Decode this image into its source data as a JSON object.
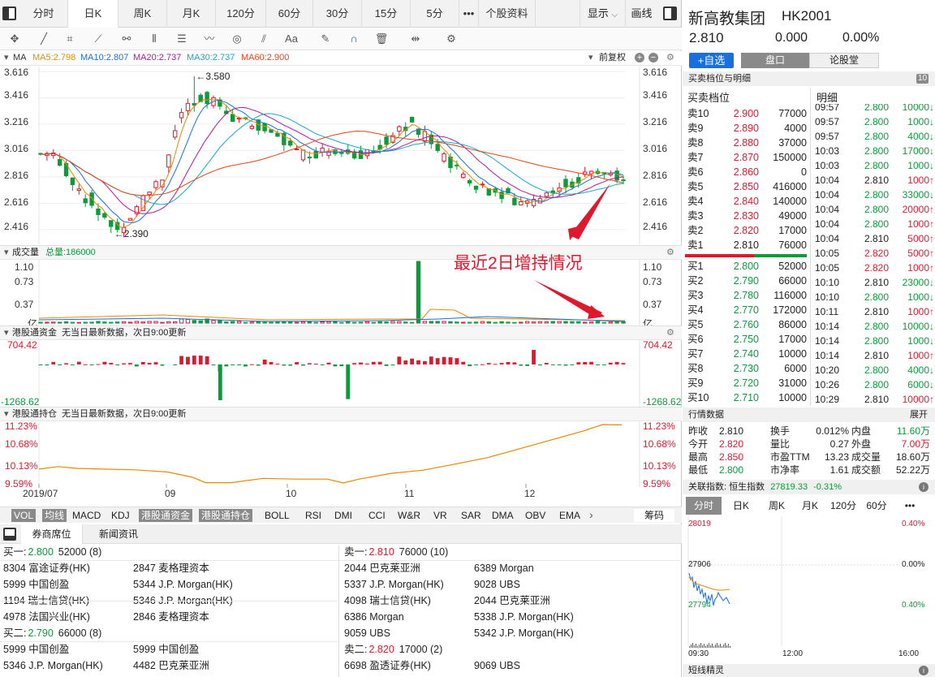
{
  "period_tabs": [
    "分时",
    "日K",
    "周K",
    "月K",
    "120分",
    "60分",
    "30分",
    "15分",
    "5分",
    "•••",
    "个股资料"
  ],
  "active_tab": 1,
  "display_label": "显示",
  "draw_label": "画线",
  "ma_panel": {
    "label": "MA",
    "ma5": "MA5:2.798",
    "ma10": "MA10:2.807",
    "ma20": "MA20:2.737",
    "ma30": "MA30:2.737",
    "ma60": "MA60:2.900",
    "adjust": "前复权"
  },
  "price_axis": [
    "3.616",
    "3.416",
    "3.216",
    "3.016",
    "2.816",
    "2.616",
    "2.416"
  ],
  "price_max_mark": "←3.580",
  "price_min_mark": "←2.390",
  "volume_panel": {
    "label": "成交量",
    "total": "总量:186000",
    "axis": [
      "1.10",
      "0.73",
      "0.37",
      "亿"
    ]
  },
  "annotation": "最近2日增持情况",
  "flow_panel": {
    "label": "港股通资金",
    "note": "无当日最新数据，次日9:00更新",
    "top": "704.42",
    "bottom": "-1268.62"
  },
  "hold_panel": {
    "label": "港股通持仓",
    "note": "无当日最新数据，次日9:00更新",
    "axis": [
      "11.23%",
      "10.68%",
      "10.13%",
      "9.59%"
    ]
  },
  "x_axis": [
    "2019/07",
    "09",
    "10",
    "11",
    "12"
  ],
  "indicators": [
    "VOL",
    "均线",
    "MACD",
    "KDJ",
    "港股通资金",
    "港股通持仓",
    "BOLL",
    "RSI",
    "DMI",
    "CCI",
    "W&R",
    "VR",
    "SAR",
    "DMA",
    "OBV",
    "EMA"
  ],
  "indicator_more": "›",
  "chip_label": "筹码",
  "bottom_tabs": [
    "券商席位",
    "新闻资讯"
  ],
  "brokers_buy": {
    "buy1_label": "买一:",
    "buy1_price": "2.800",
    "buy1_rest": "52000 (8)",
    "rows1": [
      [
        "8304 富途证券(HK)",
        "2847 麦格理资本"
      ],
      [
        "5999 中国创盈",
        "5344 J.P. Morgan(HK)"
      ],
      [
        "1194 瑞士信贷(HK)",
        "5346 J.P. Morgan(HK)"
      ],
      [
        "4978 法国兴业(HK)",
        "2846 麦格理资本"
      ]
    ],
    "buy2_label": "买二:",
    "buy2_price": "2.790",
    "buy2_rest": "66000 (8)",
    "rows2": [
      [
        "5999 中国创盈",
        "5999 中国创盈"
      ],
      [
        "5346 J.P. Morgan(HK)",
        "4482 巴克莱亚洲"
      ]
    ]
  },
  "brokers_sell": {
    "sell1_label": "卖一:",
    "sell1_price": "2.810",
    "sell1_rest": "76000 (10)",
    "rows1": [
      [
        "2044 巴克莱亚洲",
        "6389 Morgan"
      ],
      [
        "5337 J.P. Morgan(HK)",
        "9028 UBS"
      ],
      [
        "4098 瑞士信贷(HK)",
        "2044 巴克莱亚洲"
      ],
      [
        "6386 Morgan",
        "5338 J.P. Morgan(HK)"
      ],
      [
        "9059 UBS",
        "5342 J.P. Morgan(HK)"
      ]
    ],
    "sell2_label": "卖二:",
    "sell2_price": "2.820",
    "sell2_rest": "17000 (2)",
    "rows2": [
      [
        "6698 盈透证券(HK)",
        "9069 UBS"
      ]
    ]
  },
  "stock": {
    "name": "新高教集团",
    "code": "HK2001",
    "price": "2.810",
    "change": "0.000",
    "pct": "0.00%"
  },
  "right_tabs": {
    "add": "+自选",
    "book": "盘口",
    "forum": "论股堂"
  },
  "order_section": {
    "title": "买卖档位与明细",
    "badge": "10",
    "book_title": "买卖档位",
    "tick_title": "明细"
  },
  "asks": [
    [
      "卖10",
      "2.900",
      "77000"
    ],
    [
      "卖9",
      "2.890",
      "4000"
    ],
    [
      "卖8",
      "2.880",
      "37000"
    ],
    [
      "卖7",
      "2.870",
      "150000"
    ],
    [
      "卖6",
      "2.860",
      "0"
    ],
    [
      "卖5",
      "2.850",
      "416000"
    ],
    [
      "卖4",
      "2.840",
      "140000"
    ],
    [
      "卖3",
      "2.830",
      "49000"
    ],
    [
      "卖2",
      "2.820",
      "17000"
    ],
    [
      "卖1",
      "2.810",
      "76000"
    ]
  ],
  "bids": [
    [
      "买1",
      "2.800",
      "52000"
    ],
    [
      "买2",
      "2.790",
      "66000"
    ],
    [
      "买3",
      "2.780",
      "116000"
    ],
    [
      "买4",
      "2.770",
      "172000"
    ],
    [
      "买5",
      "2.760",
      "86000"
    ],
    [
      "买6",
      "2.750",
      "17000"
    ],
    [
      "买7",
      "2.740",
      "10000"
    ],
    [
      "买8",
      "2.730",
      "6000"
    ],
    [
      "买9",
      "2.720",
      "31000"
    ],
    [
      "买10",
      "2.710",
      "10000"
    ]
  ],
  "ticks": [
    [
      "09:57",
      "2.800",
      "10000↓"
    ],
    [
      "09:57",
      "2.800",
      "1000↓"
    ],
    [
      "09:57",
      "2.800",
      "4000↓"
    ],
    [
      "10:03",
      "2.800",
      "17000↓"
    ],
    [
      "10:03",
      "2.800",
      "1000↓"
    ],
    [
      "10:04",
      "2.810",
      "1000↑"
    ],
    [
      "10:04",
      "2.800",
      "33000↓"
    ],
    [
      "10:04",
      "2.800",
      "20000↑"
    ],
    [
      "10:04",
      "2.800",
      "1000↑"
    ],
    [
      "10:04",
      "2.810",
      "5000↑"
    ],
    [
      "10:05",
      "2.820",
      "5000↑"
    ],
    [
      "10:05",
      "2.820",
      "1000↑"
    ],
    [
      "10:10",
      "2.810",
      "23000↓"
    ],
    [
      "10:10",
      "2.800",
      "1000↓"
    ],
    [
      "10:11",
      "2.810",
      "1000↑"
    ],
    [
      "10:14",
      "2.800",
      "10000↓"
    ],
    [
      "10:14",
      "2.800",
      "1000↓"
    ],
    [
      "10:14",
      "2.810",
      "1000↑"
    ],
    [
      "10:20",
      "2.800",
      "4000↓"
    ],
    [
      "10:26",
      "2.800",
      "6000↓"
    ],
    [
      "10:29",
      "2.810",
      "10000↑"
    ]
  ],
  "stats_section": {
    "title": "行情数据",
    "expand": "展开"
  },
  "stats": [
    [
      "昨收",
      "2.810",
      "换手",
      "0.012%",
      "内盘",
      "11.60万"
    ],
    [
      "今开",
      "2.820",
      "量比",
      "0.27",
      "外盘",
      "7.00万"
    ],
    [
      "最高",
      "2.850",
      "市盈TTM",
      "13.23",
      "成交量",
      "18.60万"
    ],
    [
      "最低",
      "2.800",
      "市净率",
      "1.61",
      "成交额",
      "52.22万"
    ]
  ],
  "index": {
    "label": "关联指数:",
    "name": "恒生指数",
    "value": "27819.33",
    "pct": "-0.31%"
  },
  "mini_tabs": [
    "分时",
    "日K",
    "周K",
    "月K",
    "120分",
    "60分",
    "•••"
  ],
  "mini_axis": {
    "top": "28019",
    "mid": "27906",
    "bottom": "27794",
    "pct_top": "0.40%",
    "pct_mid": "0.00%",
    "pct_bottom": "0.40%"
  },
  "mini_times": [
    "09:30",
    "12:00",
    "16:00"
  ],
  "footer": "短线精灵",
  "chart_data": {
    "type": "candlestick",
    "title": "",
    "ylim": [
      2.39,
      3.616
    ],
    "x_labels": [
      "2019/07",
      "09",
      "10",
      "11",
      "12"
    ],
    "high_mark": 3.58,
    "low_mark": 2.39,
    "ma_latest": {
      "MA5": 2.798,
      "MA10": 2.807,
      "MA20": 2.737,
      "MA30": 2.737,
      "MA60": 2.9
    },
    "volume_max": 1.1,
    "flow_range": [
      -1268.62,
      704.42
    ],
    "hold_range": [
      9.59,
      11.23
    ]
  },
  "colors": {
    "up": "#e0182d",
    "down": "#0c9a3c",
    "accent": "#1a6fe0"
  }
}
